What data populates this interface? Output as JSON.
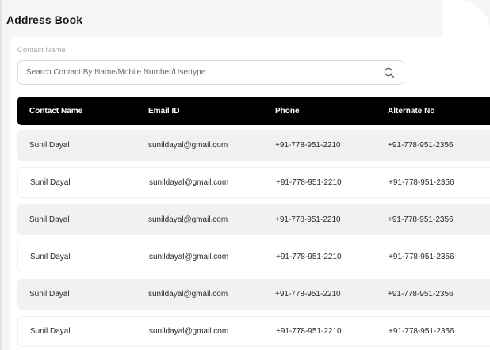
{
  "page": {
    "title": "Address Book"
  },
  "filter": {
    "label": "Contact Name",
    "placeholder": "Search Contact By Name/Mobile Number/Usertype"
  },
  "table": {
    "headers": [
      "Contact Name",
      "Email ID",
      "Phone",
      "Alternate No"
    ],
    "rows": [
      {
        "name": "Sunil Dayal",
        "email": "sunildayal@gmail.com",
        "phone": "+91-778-951-2210",
        "alt": "+91-778-951-2356"
      },
      {
        "name": "Sunil Dayal",
        "email": "sunildayal@gmail.com",
        "phone": "+91-778-951-2210",
        "alt": "+91-778-951-2356"
      },
      {
        "name": "Sunil Dayal",
        "email": "sunildayal@gmail.com",
        "phone": "+91-778-951-2210",
        "alt": "+91-778-951-2356"
      },
      {
        "name": "Sunil Dayal",
        "email": "sunildayal@gmail.com",
        "phone": "+91-778-951-2210",
        "alt": "+91-778-951-2356"
      },
      {
        "name": "Sunil Dayal",
        "email": "sunildayal@gmail.com",
        "phone": "+91-778-951-2210",
        "alt": "+91-778-951-2356"
      },
      {
        "name": "Sunil Dayal",
        "email": "sunildayal@gmail.com",
        "phone": "+91-778-951-2210",
        "alt": "+91-778-951-2356"
      }
    ]
  },
  "icons": {
    "search": "search-icon"
  },
  "colors": {
    "header_bg": "#000000",
    "row_shade": "#f1f1f1",
    "page_bg": "#f6f6f6"
  }
}
